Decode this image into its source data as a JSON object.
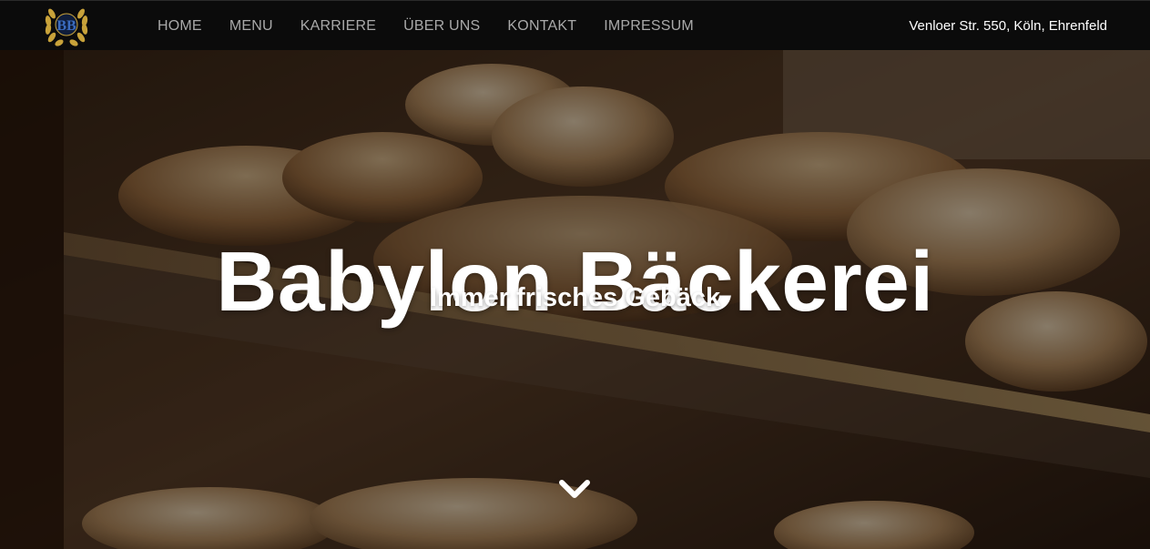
{
  "navbar": {
    "logo": {
      "icon": "bb-laurel-logo-icon",
      "monogram": "BB"
    },
    "links": [
      "HOME",
      "MENU",
      "KARRIERE",
      "ÜBER UNS",
      "KONTAKT",
      "IMPRESSUM"
    ],
    "address": "Venloer Str. 550, Köln, Ehrenfeld"
  },
  "hero": {
    "title": "Babylon Bäckerei",
    "subtitle": "Immer frisches Gebäck",
    "scroll_icon": "chevron-down-icon"
  },
  "colors": {
    "nav_background": "#0b0b0b",
    "nav_link": "#a9a9a9",
    "logo_gold": "#c8a23a",
    "logo_blue": "#1f3f7a",
    "hero_text": "#ffffff"
  }
}
